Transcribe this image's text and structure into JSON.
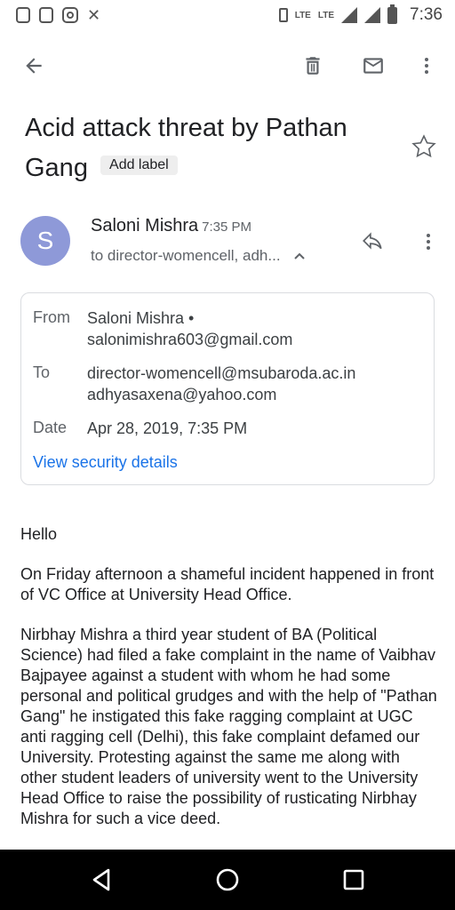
{
  "status_bar": {
    "time": "7:36",
    "lte": "LTE",
    "lte2": "LTE"
  },
  "toolbar": {
    "icons": [
      "back-icon",
      "delete-icon",
      "mail-icon",
      "more-vert-icon"
    ]
  },
  "email": {
    "subject": "Acid attack threat by Pathan Gang",
    "add_label": "Add label",
    "avatar_letter": "S",
    "sender_name": "Saloni Mishra",
    "sender_time": "7:35 PM",
    "recipients_summary": "to director-womencell, adh...",
    "details": {
      "from_label": "From",
      "from_name": "Saloni Mishra •",
      "from_email": "salonimishra603@gmail.com",
      "to_label": "To",
      "to_1": "director-womencell@msubaroda.ac.in",
      "to_2": "adhyasaxena@yahoo.com",
      "date_label": "Date",
      "date_value": "Apr 28, 2019, 7:35 PM",
      "security_link": "View security details"
    },
    "body": {
      "p1": "Hello",
      "p2": "On Friday afternoon a shameful incident happened in front of VC Office at University Head Office.",
      "p3": "Nirbhay Mishra a third year student of BA (Political Science) had filed a fake complaint in the name of Vaibhav Bajpayee against a student with whom he had some personal and political grudges and with the help of \"Pathan Gang\" he instigated this fake ragging complaint at UGC anti ragging cell (Delhi), this fake complaint defamed our University. Protesting against the same me along with other student leaders of university went to the University Head Office to raise the possibility of rusticating Nirbhay Mishra for such a vice deed."
    }
  },
  "colors": {
    "avatar": "#8e99d8",
    "link": "#1a73e8",
    "navbar": "#000000"
  }
}
